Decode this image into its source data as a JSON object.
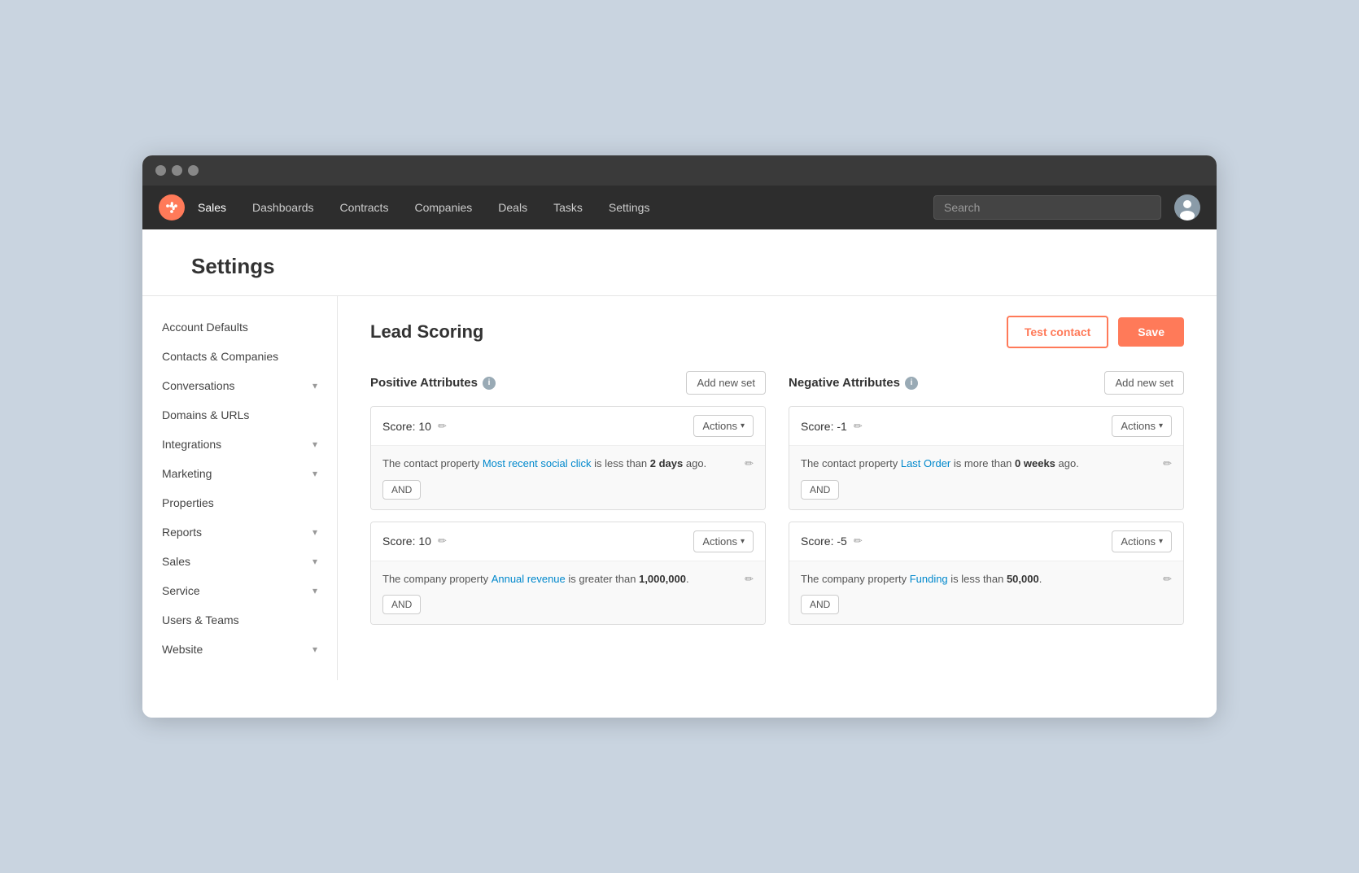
{
  "browser": {
    "dots": [
      "dot1",
      "dot2",
      "dot3"
    ]
  },
  "navbar": {
    "logo_symbol": "✦",
    "links": [
      {
        "label": "Sales",
        "active": true
      },
      {
        "label": "Dashboards",
        "active": false
      },
      {
        "label": "Contracts",
        "active": false
      },
      {
        "label": "Companies",
        "active": false
      },
      {
        "label": "Deals",
        "active": false
      },
      {
        "label": "Tasks",
        "active": false
      },
      {
        "label": "Settings",
        "active": false
      }
    ],
    "search_placeholder": "Search"
  },
  "page": {
    "title": "Settings"
  },
  "sidebar": {
    "items": [
      {
        "label": "Account Defaults",
        "has_chevron": false
      },
      {
        "label": "Contacts & Companies",
        "has_chevron": false
      },
      {
        "label": "Conversations",
        "has_chevron": true
      },
      {
        "label": "Domains & URLs",
        "has_chevron": false
      },
      {
        "label": "Integrations",
        "has_chevron": true
      },
      {
        "label": "Marketing",
        "has_chevron": true
      },
      {
        "label": "Properties",
        "has_chevron": false
      },
      {
        "label": "Reports",
        "has_chevron": true
      },
      {
        "label": "Sales",
        "has_chevron": true
      },
      {
        "label": "Service",
        "has_chevron": true
      },
      {
        "label": "Users & Teams",
        "has_chevron": false
      },
      {
        "label": "Website",
        "has_chevron": true
      }
    ]
  },
  "lead_scoring": {
    "title": "Lead Scoring",
    "test_contact_label": "Test contact",
    "save_label": "Save",
    "positive_attributes": {
      "title": "Positive Attributes",
      "add_new_set_label": "Add new set",
      "cards": [
        {
          "score_label": "Score: 10",
          "actions_label": "Actions",
          "conditions": [
            {
              "text_before": "The contact property ",
              "link": "Most recent social click",
              "text_after": " is less than ",
              "bold": "2 days",
              "text_end": " ago."
            }
          ],
          "and_label": "AND"
        },
        {
          "score_label": "Score: 10",
          "actions_label": "Actions",
          "conditions": [
            {
              "text_before": "The company property ",
              "link": "Annual revenue",
              "text_after": " is greater than ",
              "bold": "1,000,000",
              "text_end": "."
            }
          ],
          "and_label": "AND"
        }
      ]
    },
    "negative_attributes": {
      "title": "Negative Attributes",
      "add_new_set_label": "Add new set",
      "cards": [
        {
          "score_label": "Score: -1",
          "actions_label": "Actions",
          "conditions": [
            {
              "text_before": "The contact property ",
              "link": "Last Order",
              "text_after": " is more than ",
              "bold": "0 weeks",
              "text_end": " ago."
            }
          ],
          "and_label": "AND"
        },
        {
          "score_label": "Score: -5",
          "actions_label": "Actions",
          "conditions": [
            {
              "text_before": "The company property ",
              "link": "Funding",
              "text_after": " is less than ",
              "bold": "50,000",
              "text_end": "."
            }
          ],
          "and_label": "AND"
        }
      ]
    }
  }
}
